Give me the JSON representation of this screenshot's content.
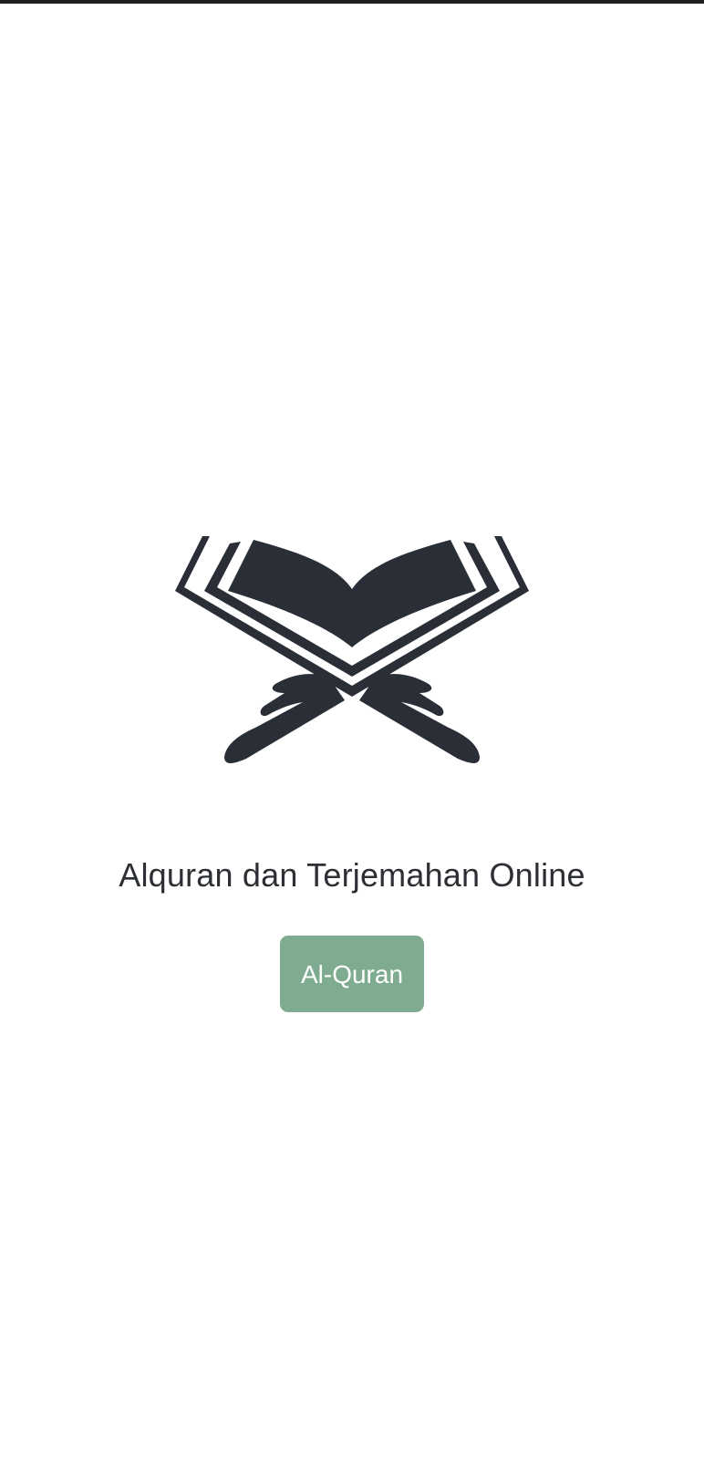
{
  "app": {
    "title": "Alquran dan Terjemahan Online",
    "button_label": "Al-Quran",
    "icon": "quran-stand-icon"
  },
  "colors": {
    "background": "#ffffff",
    "icon": "#2a2e36",
    "text": "#2c2f34",
    "button_bg": "#7fab91",
    "button_text": "#ffffff",
    "status_bar": "#1f1f1f"
  }
}
